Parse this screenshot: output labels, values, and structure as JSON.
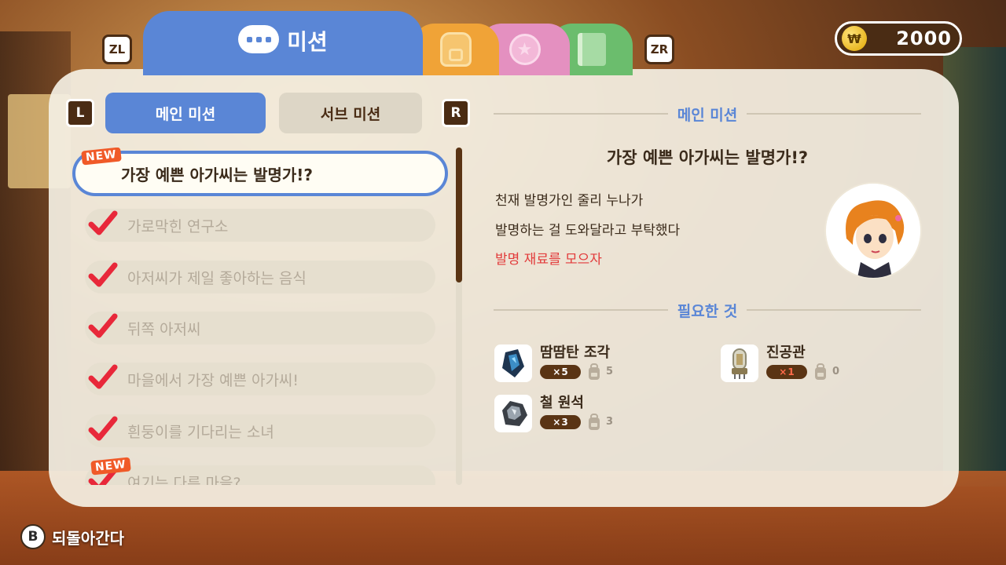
{
  "header": {
    "zl_label": "ZL",
    "zr_label": "ZR",
    "active_tab_label": "미션",
    "tabs": [
      "backpack-icon",
      "award-icon",
      "book-icon"
    ],
    "coins": "2000",
    "coin_symbol": "₩"
  },
  "left": {
    "l_key": "L",
    "r_key": "R",
    "tab_main": "메인 미션",
    "tab_sub": "서브 미션",
    "selected_badge": "NEW",
    "selected_item": "가장 예쁜 아가씨는 발명가!?",
    "completed_items": [
      "가로막힌 연구소",
      "아저씨가 제일 좋아하는 음식",
      "뒤쪽 아저씨",
      "마을에서 가장 예쁜 아가씨!",
      "흰둥이를 기다리는 소녀"
    ],
    "last_badge": "NEW",
    "last_item": "여기는 다른 마을?",
    "scroll_fraction": 0.4
  },
  "right": {
    "section_title": "메인 미션",
    "mission_title": "가장 예쁜 아가씨는 발명가!?",
    "desc_line1": "천재 발명가인 줄리 누나가",
    "desc_line2": "발명하는 걸 도와달라고 부탁했다",
    "objective": "발명 재료를 모으자",
    "required_title": "필요한 것",
    "required": [
      {
        "name": "땀땀탄 조각",
        "need": "5",
        "owned": "5"
      },
      {
        "name": "철 원석",
        "need": "3",
        "owned": "3"
      },
      {
        "name": "진공관",
        "need": "1",
        "owned": "0"
      }
    ],
    "times": "×"
  },
  "footer": {
    "b_key": "B",
    "back_label": "되돌아간다"
  },
  "colors": {
    "accent_blue": "#5a86d6",
    "brown": "#4a2c14",
    "objective_red": "#e23a3a",
    "check_red": "#e8283a"
  }
}
